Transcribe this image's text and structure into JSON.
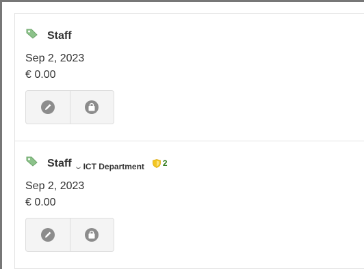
{
  "colors": {
    "tag_icon": "#8cc28a",
    "badge_shield": "#f3c623",
    "badge_count": "#2f7a18",
    "icon_circle": "#8c8c8c",
    "button_bg": "#f4f4f4",
    "divider": "#e2e2e2"
  },
  "cards": [
    {
      "title": "Staff",
      "department": "",
      "badge_count": "",
      "date": "Sep 2, 2023",
      "price": "€ 0.00",
      "icons": [
        "tag-icon",
        "edit-icon",
        "shopping-bag-icon"
      ]
    },
    {
      "title": "Staff",
      "department": "ICT Department",
      "badge_count": "2",
      "date": "Sep 2, 2023",
      "price": "€ 0.00",
      "icons": [
        "tag-icon",
        "shield-icon",
        "edit-icon",
        "shopping-bag-icon"
      ]
    }
  ]
}
